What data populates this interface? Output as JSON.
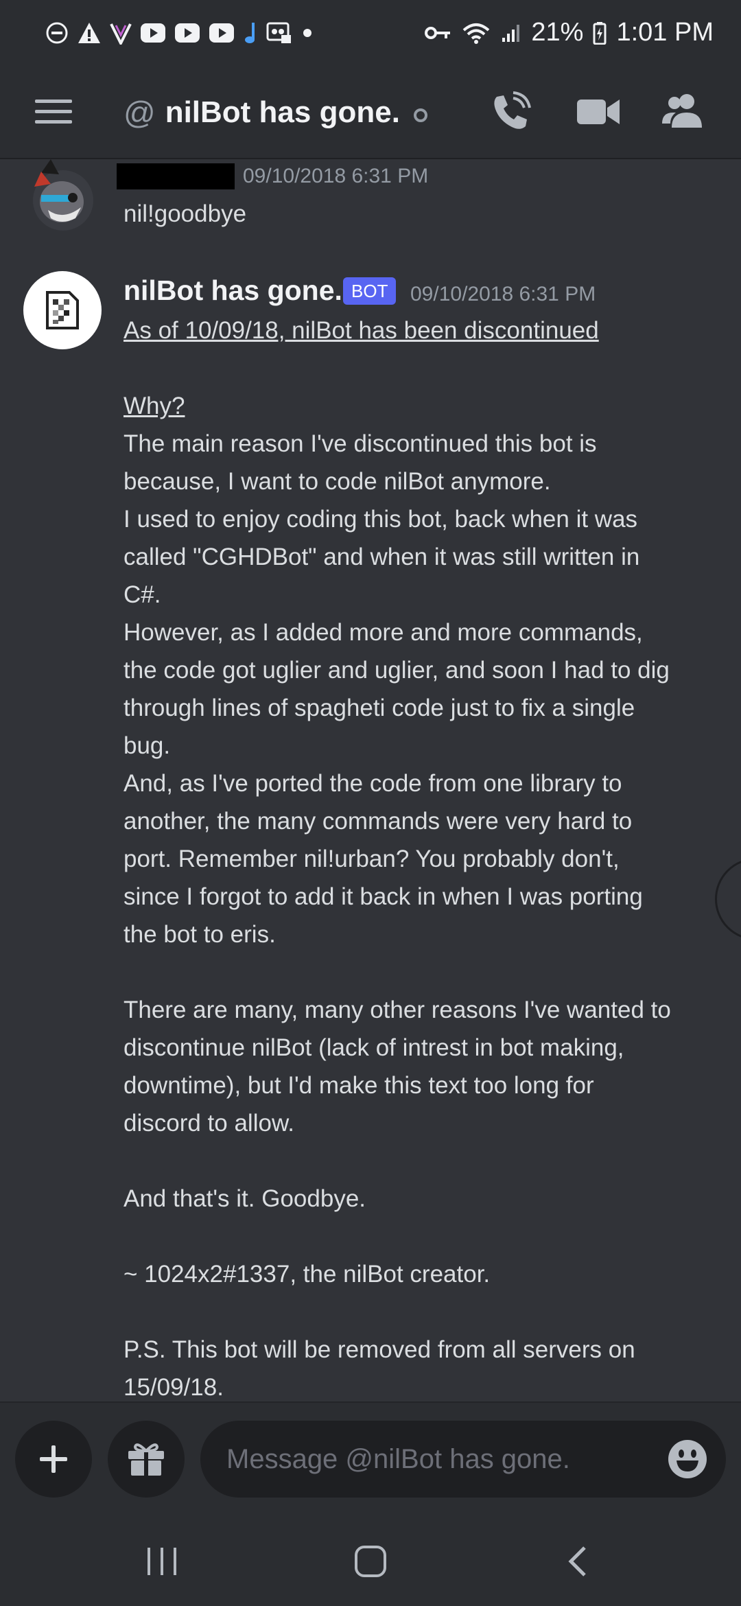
{
  "status_bar": {
    "battery": "21%",
    "time": "1:01 PM",
    "left_icons": [
      "dnd-icon",
      "alert-icon",
      "vivaldi-icon",
      "youtube-icon",
      "youtube-icon",
      "youtube-icon",
      "music-note-icon",
      "voicemail-icon",
      "dot-icon"
    ],
    "right_icons": [
      "key-icon",
      "wifi-icon",
      "signal-icon",
      "battery-charging-icon"
    ]
  },
  "header": {
    "at_symbol": "@",
    "title": "nilBot has gone.",
    "icons": [
      "menu-icon",
      "call-icon",
      "video-icon",
      "members-icon"
    ]
  },
  "messages": [
    {
      "author": "",
      "timestamp": "09/10/2018 6:31 PM",
      "text": "nil!goodbye"
    },
    {
      "author": "nilBot has gone.",
      "badge": "BOT",
      "timestamp": "09/10/2018 6:31 PM",
      "heading": "As of 10/09/18, nilBot has been discontinued",
      "why": "Why?",
      "body": "The main reason I've discontinued this bot is\nbecause, I want to code nilBot anymore.\nI used to enjoy coding this bot, back when it was\ncalled \"CGHDBot\" and when it was still written in\nC#.\nHowever, as I added more and more commands,\nthe code got uglier and uglier, and soon I had to dig\nthrough lines of spagheti code just to fix a single\nbug.\nAnd, as I've ported the code from one library to\nanother, the many commands were very hard to\nport. Remember nil!urban? You probably don't,\nsince I forgot to add it back in when I was porting\nthe bot to eris.\n\nThere are many, many other reasons I've wanted to\ndiscontinue nilBot (lack of intrest in bot making,\ndowntime), but I'd make this text too long for\ndiscord to allow.\n\nAnd that's it. Goodbye.\n\n~ 1024x2#1337, the nilBot creator.\n\nP.S. This bot will be removed from all servers on\n15/09/18."
    }
  ],
  "composer": {
    "placeholder": "Message @nilBot has gone."
  },
  "colors": {
    "background": "#313338",
    "bar": "#2b2d31",
    "input": "#1e1f22",
    "bot_badge": "#5865f2"
  }
}
